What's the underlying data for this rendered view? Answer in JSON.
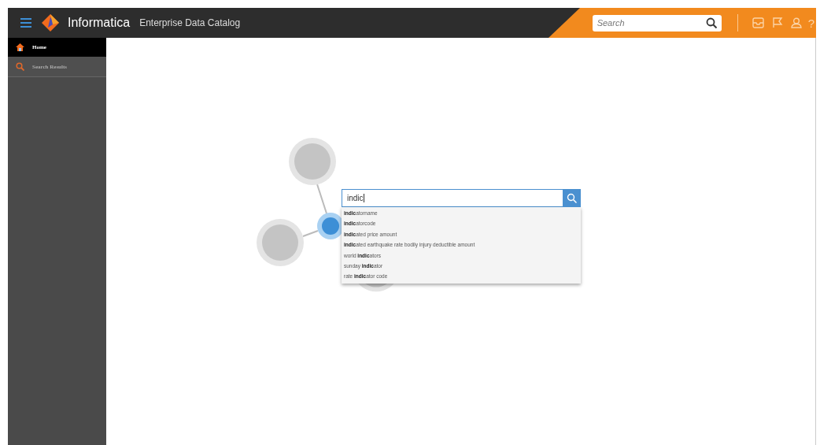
{
  "header": {
    "brand": "Informatica",
    "product": "Enterprise Data Catalog",
    "search": {
      "placeholder": "Search"
    },
    "help": "?"
  },
  "sidebar": {
    "items": [
      {
        "label": "Home",
        "selected": true
      },
      {
        "label": "Search Results",
        "selected": false
      }
    ]
  },
  "search_box": {
    "value": "indic",
    "suggestions": [
      "**indic**atorname",
      "**indic**atorcode",
      "**indic**ated price amount",
      "**indic**ated earthquake rate bodily injury deductible amount",
      "world **indic**ators",
      "sunday **indic**ator",
      "rate **indic**ator code"
    ]
  }
}
